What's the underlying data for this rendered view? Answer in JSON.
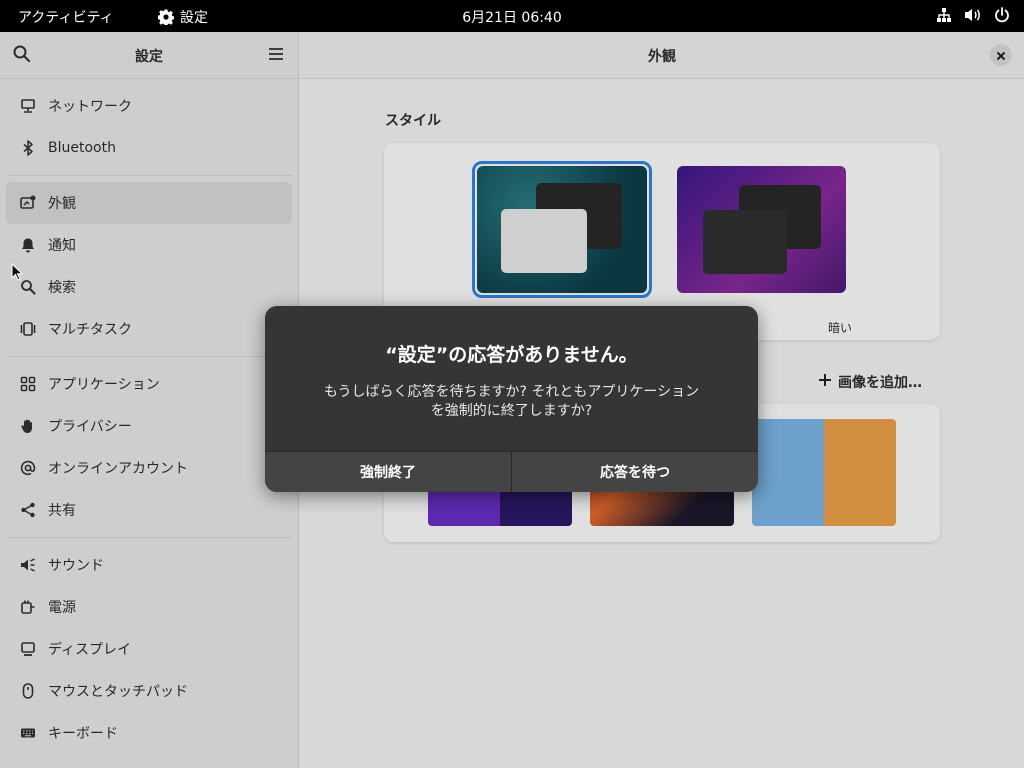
{
  "topbar": {
    "activities": "アクティビティ",
    "app_name": "設定",
    "clock": "6月21日 06:40"
  },
  "sidebar": {
    "title": "設定",
    "groups": [
      [
        {
          "label": "ネットワーク",
          "icon": "network-icon"
        },
        {
          "label": "Bluetooth",
          "icon": "bluetooth-icon"
        }
      ],
      [
        {
          "label": "外観",
          "icon": "appearance-icon",
          "active": true
        },
        {
          "label": "通知",
          "icon": "bell-icon"
        },
        {
          "label": "検索",
          "icon": "search-icon"
        },
        {
          "label": "マルチタスク",
          "icon": "multitask-icon"
        }
      ],
      [
        {
          "label": "アプリケーション",
          "icon": "apps-grid-icon"
        },
        {
          "label": "プライバシー",
          "icon": "hand-icon"
        },
        {
          "label": "オンラインアカウント",
          "icon": "at-icon"
        },
        {
          "label": "共有",
          "icon": "share-icon"
        }
      ],
      [
        {
          "label": "サウンド",
          "icon": "speaker-icon"
        },
        {
          "label": "電源",
          "icon": "power-plug-icon"
        },
        {
          "label": "ディスプレイ",
          "icon": "display-icon"
        },
        {
          "label": "マウスとタッチパッド",
          "icon": "mouse-icon"
        },
        {
          "label": "キーボード",
          "icon": "keyboard-icon"
        }
      ]
    ]
  },
  "main": {
    "title": "外観",
    "style_label": "スタイル",
    "dark_caption_partial": "暗い",
    "add_image": "画像を追加…"
  },
  "dialog": {
    "title": "“設定”の応答がありません。",
    "body_line1": "もうしばらく応答を待ちますか? それともアプリケーション",
    "body_line2": "を強制的に終了しますか?",
    "force_quit": "強制終了",
    "wait": "応答を待つ"
  },
  "colors": {
    "accent": "#3584e4",
    "dialog_bg": "#353535"
  }
}
